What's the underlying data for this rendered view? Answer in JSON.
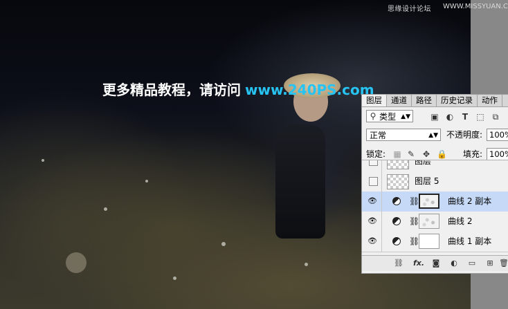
{
  "watermark": {
    "left": "思缘设计论坛",
    "right": "WWW.MISSYUAN.COM"
  },
  "banner": {
    "text": "更多精品教程，请访问",
    "url": "www.240PS.com"
  },
  "panel": {
    "tabs": [
      "图层",
      "通道",
      "路径",
      "历史记录",
      "动作"
    ],
    "filter": {
      "icon": "search-icon",
      "label": "类型"
    },
    "blend_mode": "正常",
    "opacity_label": "不透明度:",
    "opacity_value": "100%",
    "lock_label": "锁定:",
    "fill_label": "填充:",
    "fill_value": "100%",
    "layers": [
      {
        "name": "图层",
        "type": "pixel",
        "visible": false
      },
      {
        "name": "图层 5",
        "type": "pixel",
        "visible": false
      },
      {
        "name": "曲线 2 副本",
        "type": "curves",
        "visible": true,
        "selected": true
      },
      {
        "name": "曲线 2",
        "type": "curves",
        "visible": true
      },
      {
        "name": "曲线 1 副本",
        "type": "curves",
        "visible": true
      }
    ],
    "bottom_icons": [
      "link-icon",
      "fx-icon",
      "mask-icon",
      "adjustment-icon",
      "folder-icon",
      "new-layer-icon",
      "trash-icon"
    ],
    "fx_label": "fx."
  }
}
